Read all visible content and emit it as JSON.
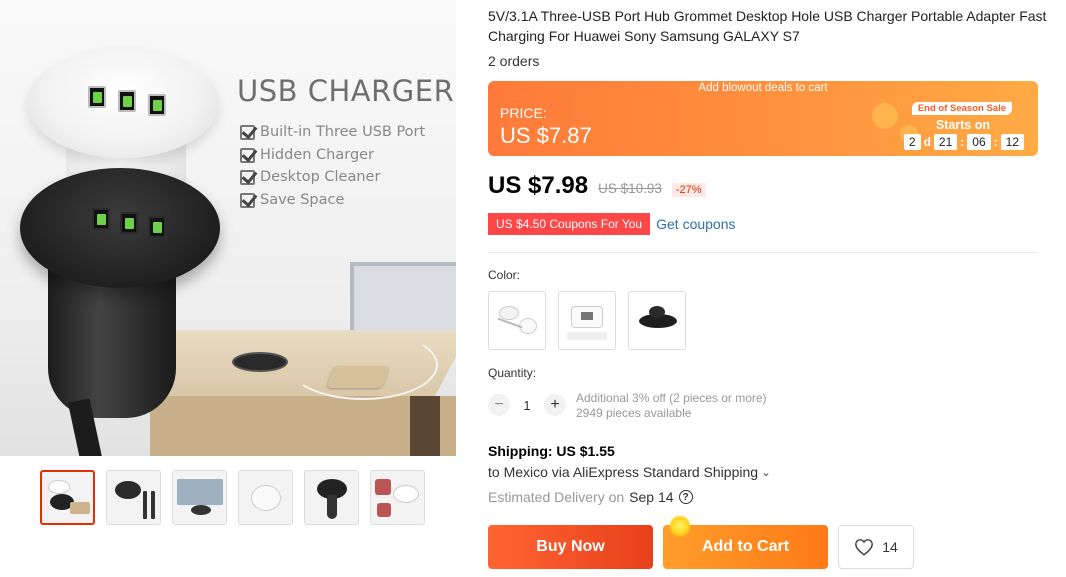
{
  "hero": {
    "title": "USB CHARGER",
    "features": [
      "Built-in Three USB Port",
      "Hidden Charger",
      "Desktop Cleaner",
      "Save Space"
    ]
  },
  "thumbnails": [
    {
      "name": "thumb-1",
      "active": true
    },
    {
      "name": "thumb-2",
      "active": false
    },
    {
      "name": "thumb-3",
      "active": false
    },
    {
      "name": "thumb-4",
      "active": false
    },
    {
      "name": "thumb-5",
      "active": false
    },
    {
      "name": "thumb-6",
      "active": false
    }
  ],
  "product": {
    "title": "5V/3.1A Three-USB Port Hub Grommet Desktop Hole USB Charger Portable Adapter Fast Charging For Huawei Sony Samsung GALAXY S7",
    "orders": "2 orders"
  },
  "promo": {
    "banner": "Add blowout deals to cart",
    "price_label": "PRICE:",
    "price": "US $7.87",
    "sale_tag": "End of Season Sale",
    "starts_on": "Starts on",
    "countdown": {
      "days": "2",
      "days_unit": "d",
      "hours": "21",
      "minutes": "06",
      "seconds": "12",
      "sep": ":"
    }
  },
  "pricing": {
    "current": "US $7.98",
    "original": "US $10.93",
    "discount": "-27%"
  },
  "coupon": {
    "tag": "US $4.50 Coupons For You",
    "link": "Get coupons"
  },
  "color": {
    "label": "Color:",
    "options": [
      "white-set",
      "white-box",
      "black-set"
    ]
  },
  "quantity": {
    "label": "Quantity:",
    "value": "1",
    "minus": "−",
    "plus": "+",
    "note_1": "Additional 3% off (2 pieces or more)",
    "note_2": "2949 pieces available"
  },
  "shipping": {
    "title": "Shipping: US $1.55",
    "destination": "to Mexico via AliExpress Standard Shipping",
    "chevron": "⌄",
    "delivery_label": "Estimated Delivery on",
    "delivery_date": "Sep 14",
    "help": "?"
  },
  "actions": {
    "buy_now": "Buy Now",
    "add_to_cart": "Add to Cart",
    "wishlist_count": "14"
  },
  "colors": {
    "accent": "#ff4747",
    "buy_gradient": "#e8401b",
    "cart_gradient": "#ff7a17",
    "promo_gradient": "#ff8f3d",
    "link": "#2e6fb0"
  }
}
